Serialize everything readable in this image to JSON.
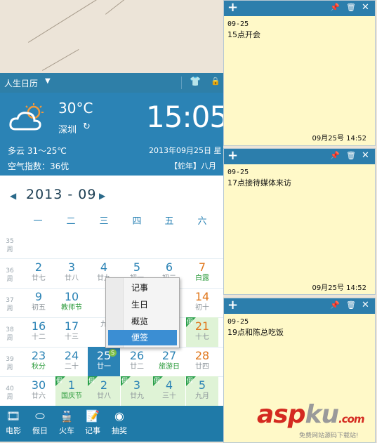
{
  "calendar": {
    "title": "人生日历",
    "weather": {
      "temperature": "30°C",
      "city": "深圳",
      "description": "多云 31～25℃",
      "air_quality": "空气指数：36优"
    },
    "clock": "15:05",
    "date_text": "2013年09月25日 星",
    "lunar_year": "【蛇年】八月",
    "month_label": "2013 - 09",
    "weekdays": [
      "一",
      "二",
      "三",
      "四",
      "五",
      "六"
    ],
    "week_suffix": "周",
    "weeks": [
      {
        "num": "35",
        "days": []
      },
      {
        "num": "36",
        "days": [
          {
            "d": "2",
            "l": "廿七"
          },
          {
            "d": "3",
            "l": "廿八"
          },
          {
            "d": "4",
            "l": "廿九"
          },
          {
            "d": "5",
            "l": "初一"
          },
          {
            "d": "6",
            "l": "初二"
          },
          {
            "d": "7",
            "l": "白露"
          }
        ]
      },
      {
        "num": "37",
        "days": [
          {
            "d": "9",
            "l": "初五"
          },
          {
            "d": "10",
            "l": "教师节"
          },
          {
            "d": "",
            "l": ""
          },
          {
            "d": "",
            "l": ""
          },
          {
            "d": "",
            "l": ""
          },
          {
            "d": "14",
            "l": "初十"
          }
        ]
      },
      {
        "num": "38",
        "days": [
          {
            "d": "16",
            "l": "十二"
          },
          {
            "d": "17",
            "l": "十三"
          },
          {
            "d": "",
            "l": "九"
          },
          {
            "d": "",
            "l": ""
          },
          {
            "d": "",
            "l": ""
          },
          {
            "d": "21",
            "l": "十七"
          }
        ]
      },
      {
        "num": "39",
        "days": [
          {
            "d": "23",
            "l": "秋分"
          },
          {
            "d": "24",
            "l": "二十"
          },
          {
            "d": "25",
            "l": "廿一"
          },
          {
            "d": "26",
            "l": "廿二"
          },
          {
            "d": "27",
            "l": "旅游日"
          },
          {
            "d": "28",
            "l": "廿四"
          }
        ]
      },
      {
        "num": "40",
        "days": [
          {
            "d": "30",
            "l": "廿六"
          },
          {
            "d": "1",
            "l": "国庆节"
          },
          {
            "d": "2",
            "l": "廿八"
          },
          {
            "d": "3",
            "l": "廿九"
          },
          {
            "d": "4",
            "l": "三十"
          },
          {
            "d": "5",
            "l": "九月"
          }
        ]
      }
    ],
    "holiday_flag": "假",
    "today_badge": "S",
    "bottom_bar": [
      {
        "icon": "film-reel-icon",
        "label": "电影"
      },
      {
        "icon": "holiday-icon",
        "label": "假日"
      },
      {
        "icon": "train-icon",
        "label": "火车"
      },
      {
        "icon": "notepad-icon",
        "label": "记事"
      },
      {
        "icon": "weibo-icon",
        "label": "抽奖"
      }
    ]
  },
  "context_menu": {
    "items": [
      "记事",
      "生日",
      "概览",
      "便签"
    ],
    "selected": "便签"
  },
  "sticky_notes": [
    {
      "date": "09-25",
      "text": "15点开会",
      "stamp": "09月25号  14:52"
    },
    {
      "date": "09-25",
      "text": "17点接待媒体来访",
      "stamp": "09月25号  14:52"
    },
    {
      "date": "09-25",
      "text": "19点和陈总吃饭",
      "stamp": ""
    }
  ],
  "watermark": {
    "logo_a": "asp",
    "logo_b": "ku",
    "logo_c": ".com",
    "tagline": "免费网站源码下载站!"
  },
  "colors": {
    "accent": "#2b83b5",
    "holiday_green": "#2aa04a",
    "weekend_orange": "#e0761a",
    "note_yellow": "#fff9c8"
  }
}
